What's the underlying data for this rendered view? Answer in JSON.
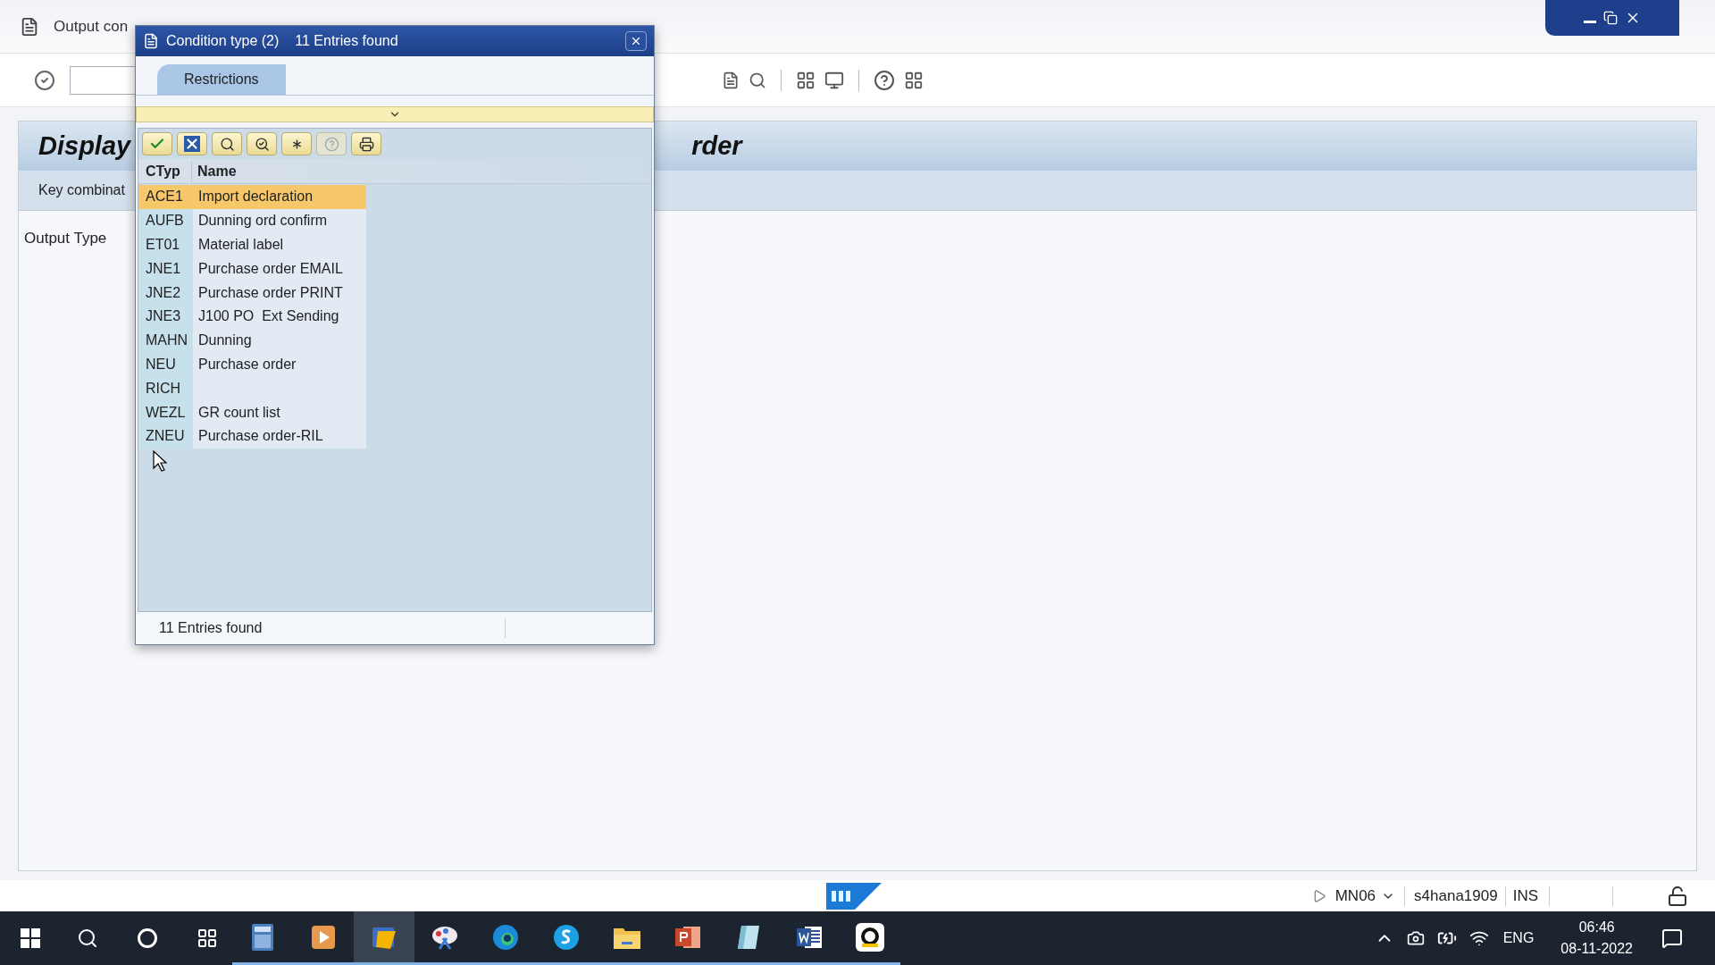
{
  "window": {
    "title": "Output con"
  },
  "header": {
    "title_left": "Display",
    "title_right": "rder",
    "subheader": "Key combinat"
  },
  "field_label": "Output Type",
  "dialog": {
    "title": "Condition type (2)",
    "subtitle": "11 Entries found",
    "tabs": [
      {
        "label": "Restrictions",
        "selected": true
      }
    ],
    "columns": [
      "CTyp",
      "Name"
    ],
    "rows": [
      {
        "ctyp": "ACE1",
        "name": "Import declaration",
        "selected": true
      },
      {
        "ctyp": "AUFB",
        "name": "Dunning ord confirm",
        "selected": false
      },
      {
        "ctyp": "ET01",
        "name": "Material label",
        "selected": false
      },
      {
        "ctyp": "JNE1",
        "name": "Purchase order EMAIL",
        "selected": false
      },
      {
        "ctyp": "JNE2",
        "name": "Purchase order PRINT",
        "selected": false
      },
      {
        "ctyp": "JNE3",
        "name": "J100 PO  Ext Sending",
        "selected": false
      },
      {
        "ctyp": "MAHN",
        "name": "Dunning",
        "selected": false
      },
      {
        "ctyp": "NEU",
        "name": "Purchase order",
        "selected": false
      },
      {
        "ctyp": "RICH",
        "selected": false
      },
      {
        "ctyp": "WEZL",
        "name": "GR count list",
        "selected": false
      },
      {
        "ctyp": "ZNEU",
        "name": "Purchase order-RIL",
        "selected": false
      }
    ],
    "status": "11 Entries found"
  },
  "status_bar": {
    "transaction": "MN06",
    "system": "s4hana1909",
    "mode": "INS"
  },
  "taskbar": {
    "apps": [
      {
        "kind": "calculator",
        "selected": false
      },
      {
        "kind": "player",
        "selected": false
      },
      {
        "kind": "sap",
        "selected": true
      },
      {
        "kind": "paint",
        "selected": false
      },
      {
        "kind": "edge",
        "selected": false
      },
      {
        "kind": "skype",
        "selected": false
      },
      {
        "kind": "folder",
        "selected": false
      },
      {
        "kind": "powerpoint",
        "selected": false
      },
      {
        "kind": "notepad",
        "selected": false
      },
      {
        "kind": "word",
        "selected": false
      },
      {
        "kind": "g",
        "selected": false
      }
    ],
    "language": "ENG",
    "time": "06:46",
    "date": "08-11-2022"
  }
}
